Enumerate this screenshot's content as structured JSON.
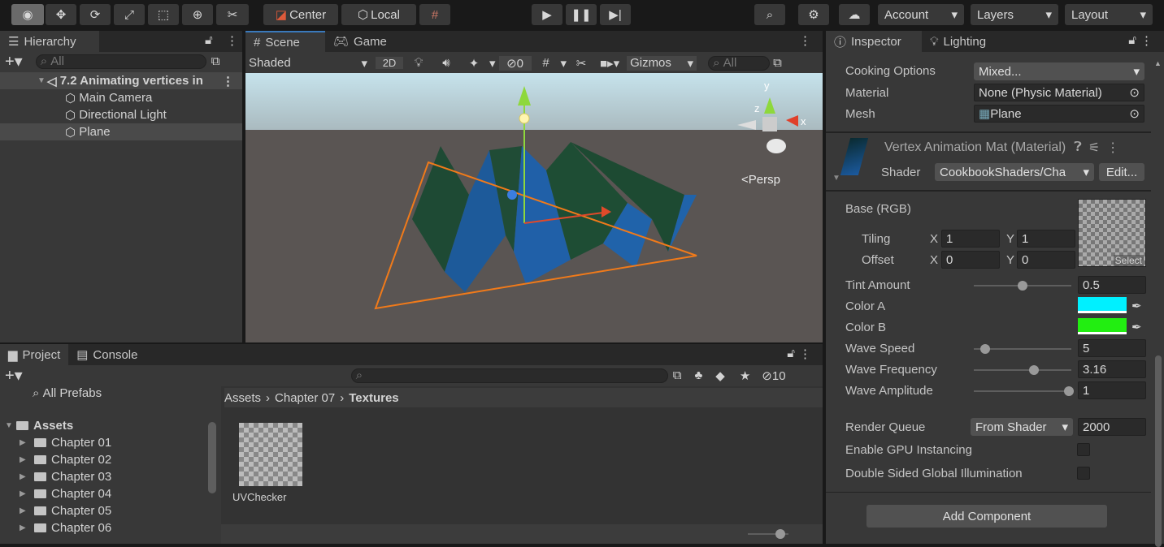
{
  "toolbar": {
    "tools": [
      "view-tool",
      "move-tool",
      "rotate-tool",
      "scale-tool",
      "rect-tool",
      "transform-tool",
      "custom-tool"
    ],
    "pivot": "Center",
    "space": "Local",
    "account": "Account",
    "layers": "Layers",
    "layout": "Layout"
  },
  "hierarchy": {
    "tab": "Hierarchy",
    "search_placeholder": "All",
    "scene": "7.2 Animating vertices in",
    "items": [
      "Main Camera",
      "Directional Light",
      "Plane"
    ],
    "selected": "Plane"
  },
  "scene": {
    "tabs": [
      "Scene",
      "Game"
    ],
    "draw_mode": "Shaded",
    "mode_2d": "2D",
    "hidden_count": "0",
    "gizmos": "Gizmos",
    "search_placeholder": "All",
    "projection": "Persp",
    "gizmo_axes": {
      "x": "x",
      "y": "y",
      "z": "z"
    }
  },
  "project": {
    "tabs": [
      "Project",
      "Console"
    ],
    "hidden_count": "10",
    "favorites": "All Prefabs",
    "assets_label": "Assets",
    "folders": [
      "Chapter 01",
      "Chapter 02",
      "Chapter 03",
      "Chapter 04",
      "Chapter 05",
      "Chapter 06"
    ],
    "breadcrumb": [
      "Assets",
      "Chapter 07",
      "Textures"
    ],
    "files": [
      "UVChecker"
    ]
  },
  "inspector": {
    "tabs": [
      "Inspector",
      "Lighting"
    ],
    "cooking_options": {
      "label": "Cooking Options",
      "value": "Mixed..."
    },
    "material": {
      "label": "Material",
      "value": "None (Physic Material)"
    },
    "mesh": {
      "label": "Mesh",
      "value": "Plane"
    },
    "mat_title": "Vertex Animation Mat (Material)",
    "shader": {
      "label": "Shader",
      "value": "CookbookShaders/Cha",
      "edit": "Edit..."
    },
    "base": {
      "label": "Base (RGB)",
      "tiling": "Tiling",
      "offset": "Offset",
      "x": "X",
      "y": "Y",
      "tiling_x": "1",
      "tiling_y": "1",
      "offset_x": "0",
      "offset_y": "0",
      "select": "Select"
    },
    "tint_amount": {
      "label": "Tint Amount",
      "value": "0.5",
      "fraction": 0.5
    },
    "color_a": {
      "label": "Color A",
      "color": "#00f0ff"
    },
    "color_b": {
      "label": "Color B",
      "color": "#22ee11"
    },
    "wave_speed": {
      "label": "Wave Speed",
      "value": "5",
      "fraction": 0.1
    },
    "wave_frequency": {
      "label": "Wave Frequency",
      "value": "3.16",
      "fraction": 0.62
    },
    "wave_amplitude": {
      "label": "Wave Amplitude",
      "value": "1",
      "fraction": 1.0
    },
    "render_queue": {
      "label": "Render Queue",
      "mode": "From Shader",
      "value": "2000"
    },
    "gpu_instancing": {
      "label": "Enable GPU Instancing",
      "checked": false
    },
    "double_sided_gi": {
      "label": "Double Sided Global Illumination",
      "checked": false
    },
    "add_component": "Add Component"
  }
}
